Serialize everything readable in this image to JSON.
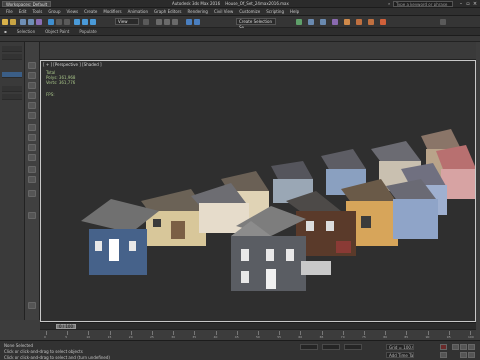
{
  "titlebar": {
    "workspace_label": "Workspaces: Default",
    "title": "Autodesk 3ds Max 2016",
    "file": "House_Of_Set_24max2016.max",
    "search_placeholder": "Type a keyword or phrase"
  },
  "menu": [
    "File",
    "Edit",
    "Tools",
    "Group",
    "Views",
    "Create",
    "Modifiers",
    "Animation",
    "Graph Editors",
    "Rendering",
    "Civil View",
    "Customize",
    "Scripting",
    "Help"
  ],
  "toolbar": {
    "view_dropdown": "View",
    "selection_set": "Create Selection Se"
  },
  "ribbon": [
    "Selection",
    "Object Paint",
    "Populate"
  ],
  "viewport": {
    "label": "[ + ] [Perspective ] [Shaded ]",
    "stats_header": "Total",
    "polys_label": "Polys:",
    "polys_value": "361,968",
    "verts_label": "Verts:",
    "verts_value": "361,776",
    "fps_label": "FPS:"
  },
  "timeline": {
    "slider_label": "0 / 100",
    "ticks": [
      "0",
      "5",
      "10",
      "15",
      "20",
      "25",
      "30",
      "35",
      "40",
      "45",
      "50",
      "55",
      "60",
      "65",
      "70",
      "75",
      "80",
      "85",
      "90",
      "95",
      "100"
    ]
  },
  "status": {
    "line1": "None Selected",
    "line2": "Click or click-and-drag to select objects",
    "line3": "Click or click-and-drag to select and (turn undefined)",
    "grid": "Grid = 100,0cm",
    "add_time_tag": "Add Time Tag",
    "auto_key": "Auto Key",
    "set_key": "Set Key"
  },
  "colors": {
    "viewport_bg": "#2f2f2f",
    "panel_bg": "#3d3d3d",
    "stats_text": "#a9c68a"
  }
}
